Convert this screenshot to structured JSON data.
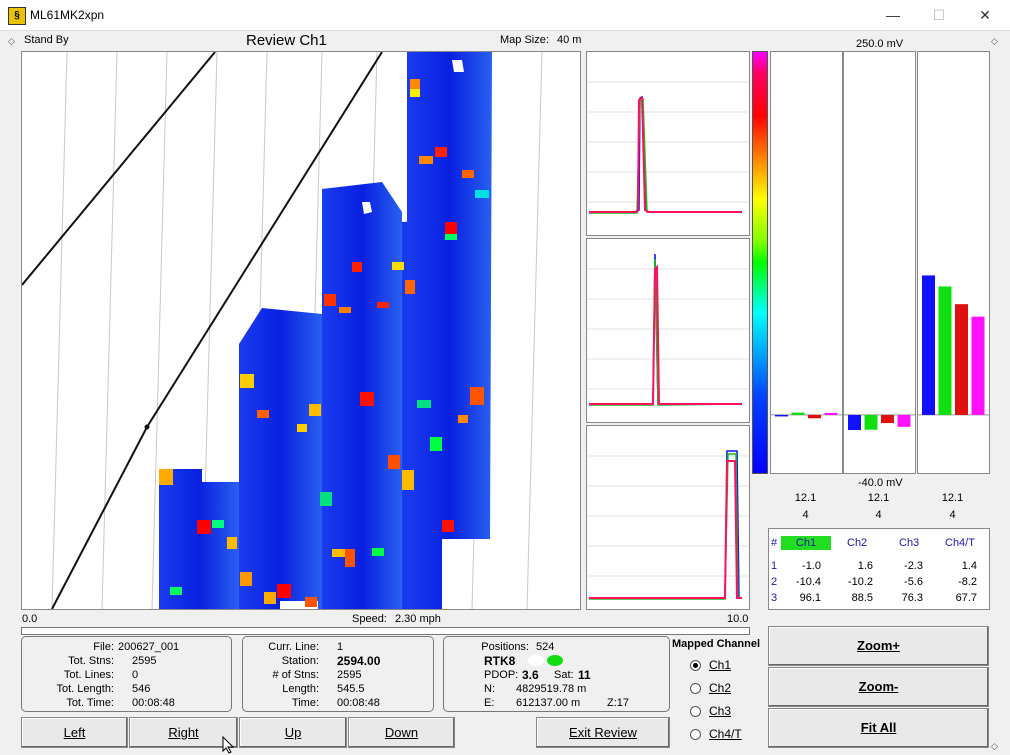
{
  "window": {
    "title": "ML61MK2xpn",
    "icon": "app-logo-icon",
    "minimize": "—",
    "maximize": "☐",
    "close": "✕"
  },
  "header": {
    "status": "Stand By",
    "review_title": "Review Ch1",
    "map_size_label": "Map Size:",
    "map_size_value": "40 m"
  },
  "map": {
    "axis_start": "0.0",
    "axis_end": "10.0",
    "speed_label": "Speed:",
    "speed_value": "2.30 mph",
    "progress": 0.0
  },
  "bars": {
    "scale_top": "250.0 mV",
    "scale_bottom": "-40.0 mV",
    "scale_max": 250.0,
    "scale_min": -40.0,
    "colors": [
      "#1010ff",
      "#10e010",
      "#e01010",
      "#ff10ff"
    ],
    "groups": [
      {
        "values": [
          -1.0,
          1.6,
          -2.3,
          1.4
        ],
        "top_value": "12.1",
        "bottom_value": "4"
      },
      {
        "values": [
          -10.4,
          -10.2,
          -5.6,
          -8.2
        ],
        "top_value": "12.1",
        "bottom_value": "4"
      },
      {
        "values": [
          96.1,
          88.5,
          76.3,
          67.7
        ],
        "top_value": "12.1",
        "bottom_value": "4"
      }
    ]
  },
  "channel_table": {
    "headers": [
      "#",
      "Ch1",
      "Ch2",
      "Ch3",
      "Ch4/T"
    ],
    "rows": [
      [
        "1",
        "-1.0",
        "1.6",
        "-2.3",
        "1.4"
      ],
      [
        "2",
        "-10.4",
        "-10.2",
        "-5.6",
        "-8.2"
      ],
      [
        "3",
        "96.1",
        "88.5",
        "76.3",
        "67.7"
      ]
    ],
    "highlight_color": "#22dd22"
  },
  "file_info": {
    "file_label": "File:",
    "file_value": "200627_001",
    "stns_label": "Tot. Stns:",
    "stns_value": "2595",
    "lines_label": "Tot. Lines:",
    "lines_value": "0",
    "length_label": "Tot. Length:",
    "length_value": "546",
    "time_label": "Tot. Time:",
    "time_value": "00:08:48"
  },
  "line_info": {
    "line_label": "Curr. Line:",
    "line_value": "1",
    "station_label": "Station:",
    "station_value": "2594.00",
    "nstns_label": "# of Stns:",
    "nstns_value": "2595",
    "length_label": "Length:",
    "length_value": "545.5",
    "time_label": "Time:",
    "time_value": "00:08:48"
  },
  "gps_info": {
    "positions_label": "Positions:",
    "positions_value": "524",
    "mode": "RTK8",
    "pdop_label": "PDOP:",
    "pdop_value": "3.6",
    "sat_label": "Sat:",
    "sat_value": "11",
    "n_label": "N:",
    "n_value": "4829519.78 m",
    "e_label": "E:",
    "e_value": "612137.00 m",
    "zone": "Z:17"
  },
  "mapped_channel": {
    "title": "Mapped Channel",
    "options": [
      {
        "label": "Ch1",
        "selected": true
      },
      {
        "label": "Ch2",
        "selected": false
      },
      {
        "label": "Ch3",
        "selected": false
      },
      {
        "label": "Ch4/T",
        "selected": false
      }
    ]
  },
  "nav": {
    "left": "Left",
    "right": "Right",
    "up": "Up",
    "down": "Down",
    "exit": "Exit Review"
  },
  "zoom": {
    "zoom_in": "Zoom+",
    "zoom_out": "Zoom-",
    "fit_all": "Fit All"
  }
}
